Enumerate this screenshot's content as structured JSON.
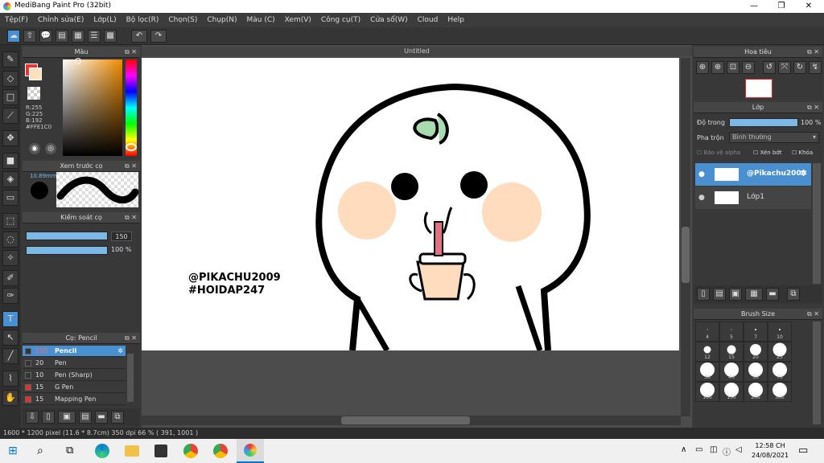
{
  "window": {
    "title": "MediBang Paint Pro (32bit)",
    "min_icon": "minimize-icon",
    "max_icon": "maximize-icon",
    "close_icon": "close-icon"
  },
  "menu": [
    "Tệp(F)",
    "Chỉnh sửa(E)",
    "Lớp(L)",
    "Bộ lọc(R)",
    "Chọn(S)",
    "Chụp(N)",
    "Màu (C)",
    "Xem(V)",
    "Công cụ(T)",
    "Cửa sổ(W)",
    "Cloud",
    "Help"
  ],
  "color_panel": {
    "title": "Màu",
    "r": "R:255",
    "g": "G:225",
    "b": "B:192",
    "hex": "#FFE1C0",
    "fg": "#FFE1C0"
  },
  "brush_preview": {
    "title": "Xem trước cọ",
    "size": "10.89mm"
  },
  "brush_control": {
    "title": "Kiểm soát cọ",
    "size": "150",
    "opacity": "100 %",
    "size_fill": 1.0,
    "opacity_fill": 1.0
  },
  "brush_list": {
    "title": "Cọ: Pencil",
    "items": [
      {
        "size": "150",
        "name": "Pencil",
        "swatch": "#3b3b3b"
      },
      {
        "size": "20",
        "name": "Pen",
        "swatch": "#3b3b3b"
      },
      {
        "size": "10",
        "name": "Pen (Sharp)",
        "swatch": "#3b3b3b"
      },
      {
        "size": "15",
        "name": "G Pen",
        "swatch": "#e03030"
      },
      {
        "size": "15",
        "name": "Mapping Pen",
        "swatch": "#e03030"
      }
    ]
  },
  "canvas": {
    "title": "Untitled",
    "watermark_line1": "@PIKACHU2009",
    "watermark_line2": "#HOIDAP247"
  },
  "navigator": {
    "title": "Hoa tiêu"
  },
  "layer_panel": {
    "title": "Lớp",
    "opacity_label": "Độ trong",
    "opacity_value": "100 %",
    "blend_label": "Pha trộn",
    "blend_value": "Bình thường",
    "protect_alpha": "Bảo vệ alpha",
    "clip": "Xén bớt",
    "lock": "Khóa",
    "layers": [
      {
        "name": "@Pikachu2009"
      },
      {
        "name": "Lớp1"
      }
    ]
  },
  "brush_size": {
    "title": "Brush Size",
    "sizes": [
      "4",
      "5",
      "7",
      "10",
      "12",
      "15",
      "20",
      "25",
      "30",
      "40",
      "50",
      "70",
      "100",
      "150",
      "200",
      "300"
    ]
  },
  "status": {
    "text": "1600 * 1200 pixel   (11.6 * 8.7cm)   350 dpi   66 %   ( 391, 1001 )"
  },
  "taskbar": {
    "time": "12:58 CH",
    "date": "24/08/2021"
  }
}
